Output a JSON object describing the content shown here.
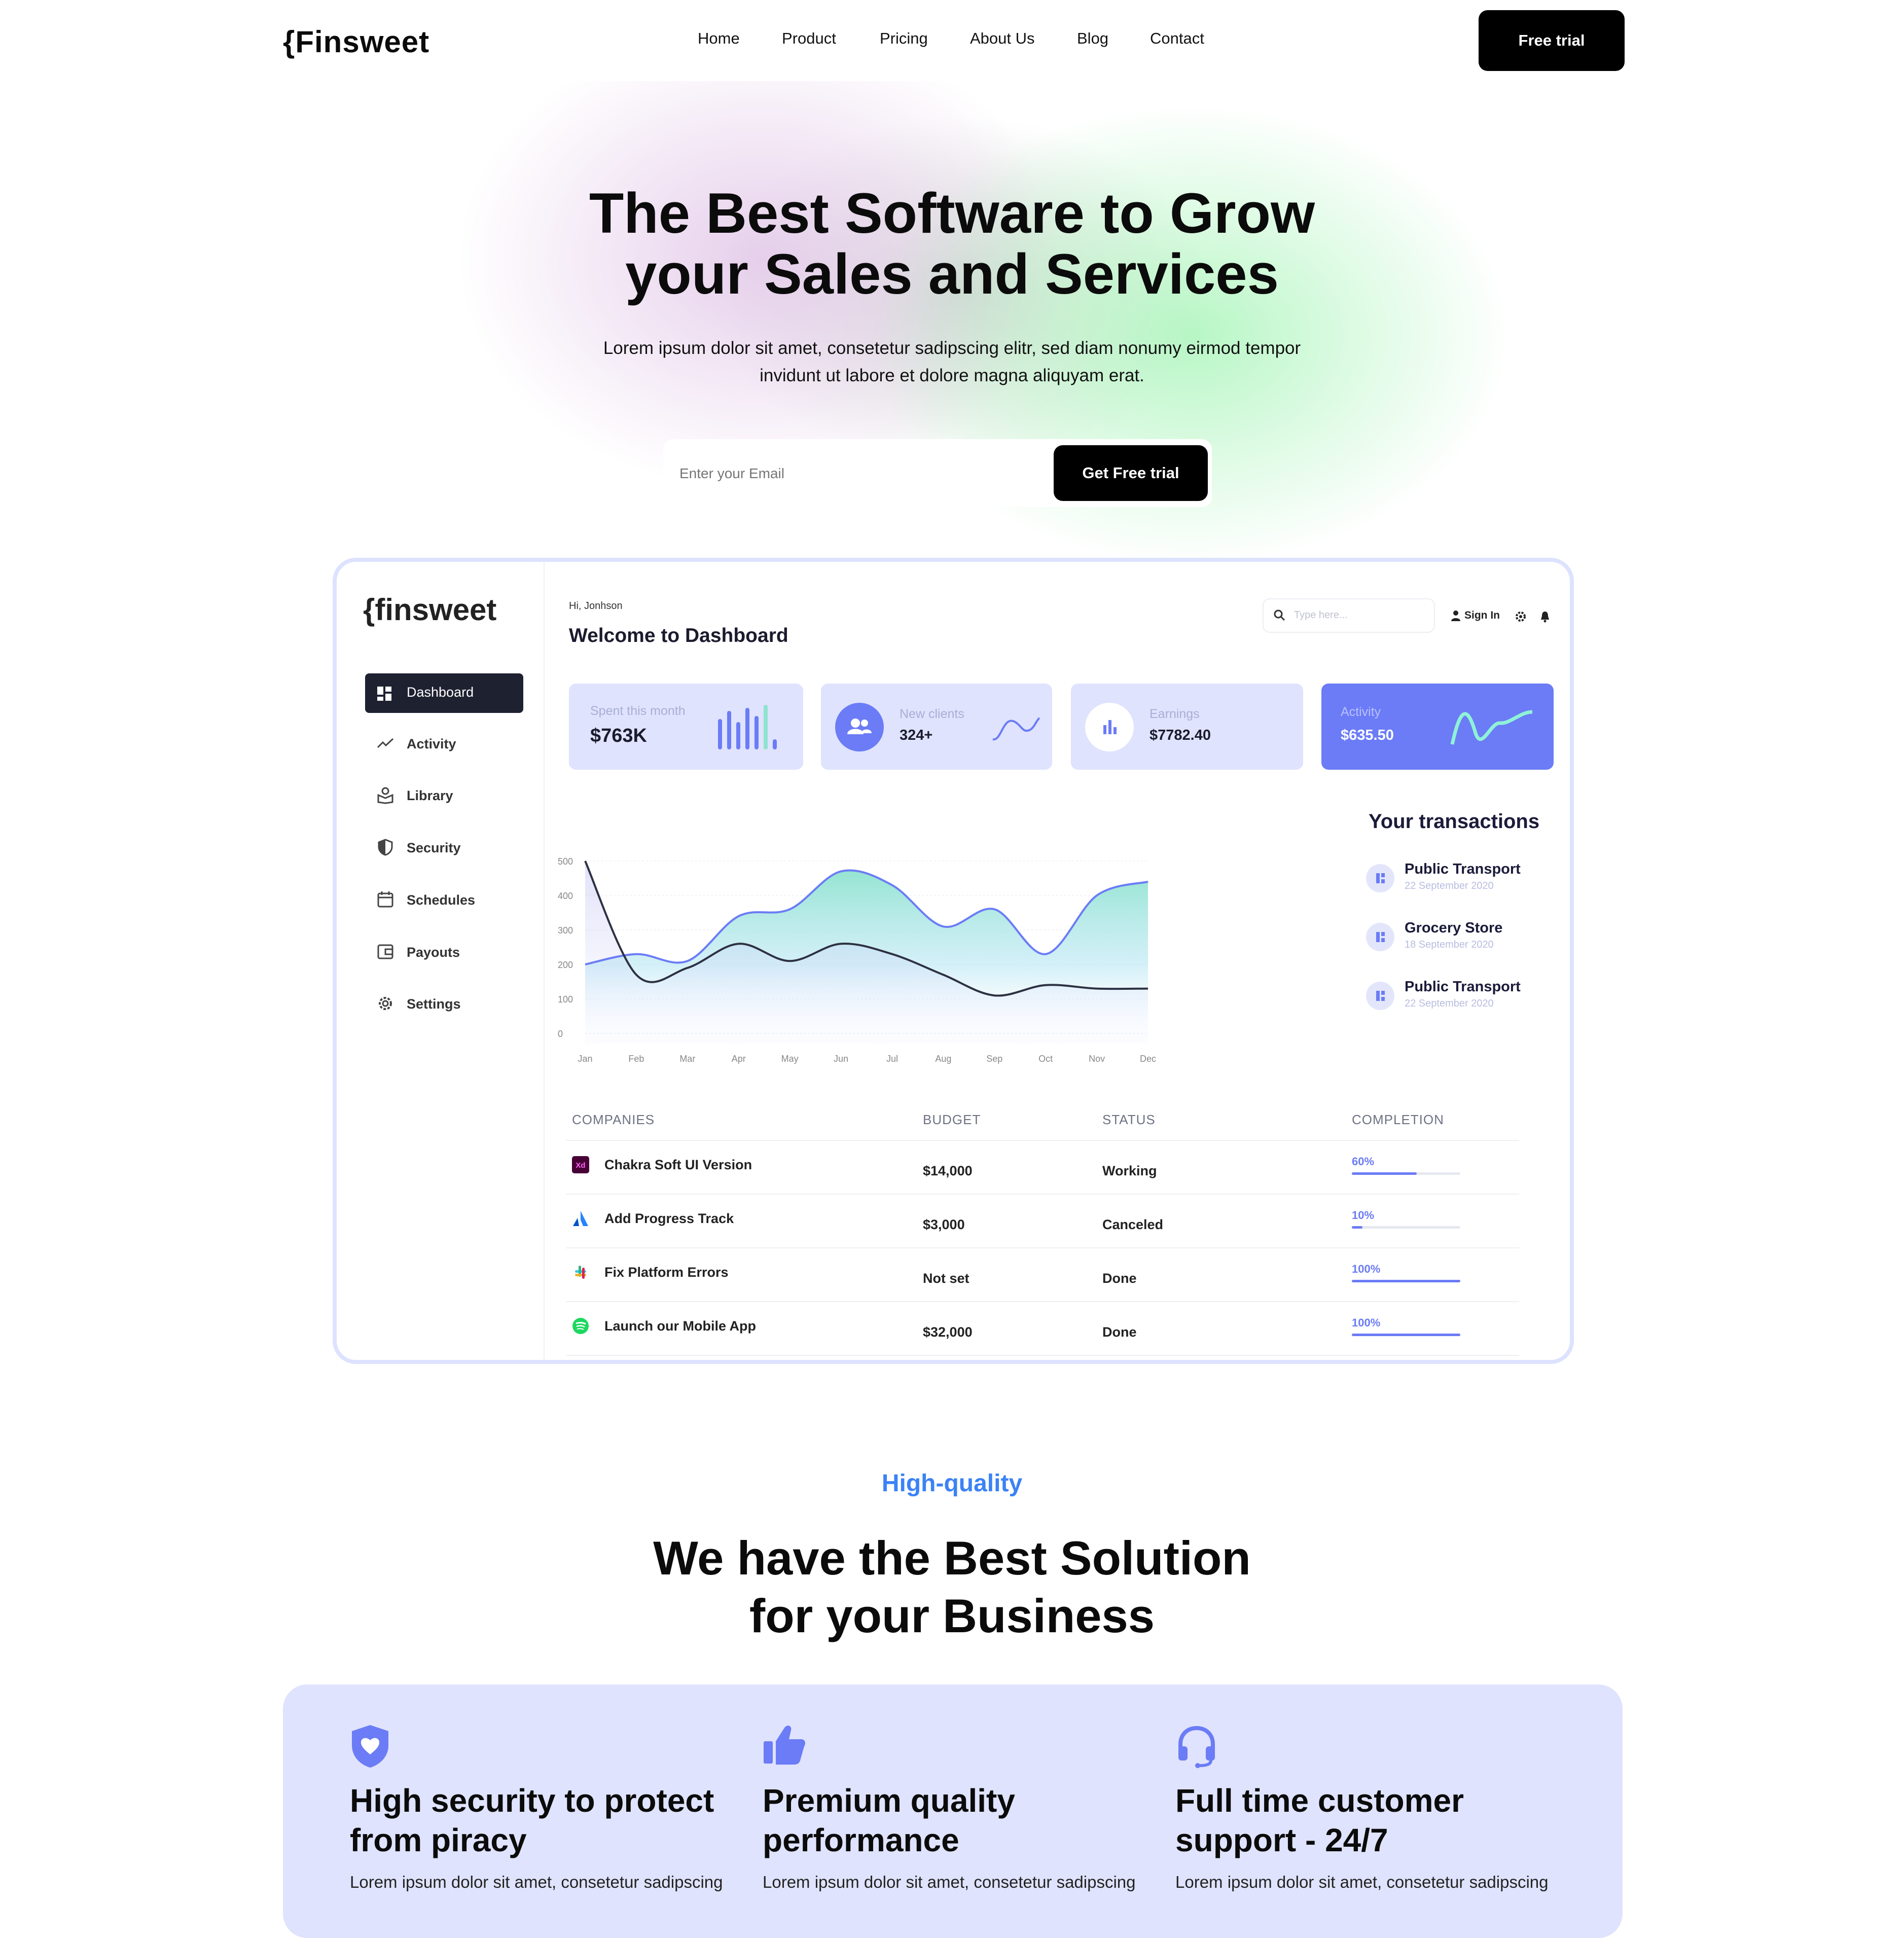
{
  "brand": {
    "name": "{Finsweet"
  },
  "nav": {
    "items": [
      "Home",
      "Product",
      "Pricing",
      "About Us",
      "Blog",
      "Contact"
    ],
    "cta": "Free trial"
  },
  "hero": {
    "title_line1": "The Best Software to Grow",
    "title_line2": "your Sales and Services",
    "subtitle_line1": "Lorem ipsum dolor sit amet, consetetur sadipscing elitr, sed diam nonumy eirmod tempor",
    "subtitle_line2": "invidunt ut labore et dolore magna aliquyam erat.",
    "email_placeholder": "Enter your Email",
    "cta": "Get Free trial"
  },
  "dashboard": {
    "logo": "{finsweet",
    "greeting": "Hi, Jonhson",
    "title": "Welcome to Dashboard",
    "search_placeholder": "Type here...",
    "sign_in": "Sign In",
    "sidebar": [
      "Dashboard",
      "Activity",
      "Library",
      "Security",
      "Schedules",
      "Payouts",
      "Settings"
    ],
    "stats": [
      {
        "label": "Spent this month",
        "value": "$763K"
      },
      {
        "label": "New clients",
        "value": "324+"
      },
      {
        "label": "Earnings",
        "value": "$7782.40"
      },
      {
        "label": "Activity",
        "value": "$635.50"
      }
    ],
    "transactions_title": "Your transactions",
    "transactions": [
      {
        "title": "Public Transport",
        "date": "22 September 2020"
      },
      {
        "title": "Grocery Store",
        "date": "18 September 2020"
      },
      {
        "title": "Public Transport",
        "date": "22 September 2020"
      }
    ],
    "table": {
      "headers": [
        "COMPANIES",
        "BUDGET",
        "STATUS",
        "COMPLETION"
      ],
      "rows": [
        {
          "company": "Chakra Soft UI Version",
          "budget": "$14,000",
          "status": "Working",
          "completion": "60%",
          "pct": 0.6
        },
        {
          "company": "Add Progress Track",
          "budget": "$3,000",
          "status": "Canceled",
          "completion": "10%",
          "pct": 0.1
        },
        {
          "company": "Fix Platform Errors",
          "budget": "Not set",
          "status": "Done",
          "completion": "100%",
          "pct": 1.0
        },
        {
          "company": "Launch our Mobile App",
          "budget": "$32,000",
          "status": "Done",
          "completion": "100%",
          "pct": 1.0
        }
      ]
    },
    "colors": {
      "accent": "#6b7cf6",
      "teal": "#8fe3cf",
      "dark_line": "#2d3142"
    }
  },
  "chart_data": {
    "type": "area",
    "categories": [
      "Jan",
      "Feb",
      "Mar",
      "Apr",
      "May",
      "Jun",
      "Jul",
      "Aug",
      "Sep",
      "Oct",
      "Nov",
      "Dec"
    ],
    "y_ticks": [
      "500",
      "400",
      "300",
      "200",
      "100",
      "0"
    ],
    "ylim": [
      0,
      500
    ],
    "series": [
      {
        "values": [
          200,
          230,
          210,
          340,
          360,
          470,
          430,
          310,
          360,
          230,
          400,
          440
        ]
      },
      {
        "values": [
          500,
          170,
          190,
          260,
          210,
          260,
          230,
          170,
          110,
          140,
          130,
          130
        ]
      }
    ]
  },
  "solutions": {
    "eyebrow": "High-quality",
    "title_line1": "We have the Best Solution",
    "title_line2": "for your Business",
    "features": [
      {
        "icon": "shield-heart-icon",
        "title_line1": "High security to protect",
        "title_line2": "from piracy",
        "text": "Lorem ipsum dolor sit amet, consetetur sadipscing"
      },
      {
        "icon": "thumbs-up-icon",
        "title_line1": "Premium quality",
        "title_line2": "performance",
        "text": "Lorem ipsum dolor sit amet, consetetur sadipscing"
      },
      {
        "icon": "headset-icon",
        "title_line1": "Full time customer",
        "title_line2": "support - 24/7",
        "text": "Lorem ipsum dolor sit amet, consetetur sadipscing"
      }
    ]
  }
}
